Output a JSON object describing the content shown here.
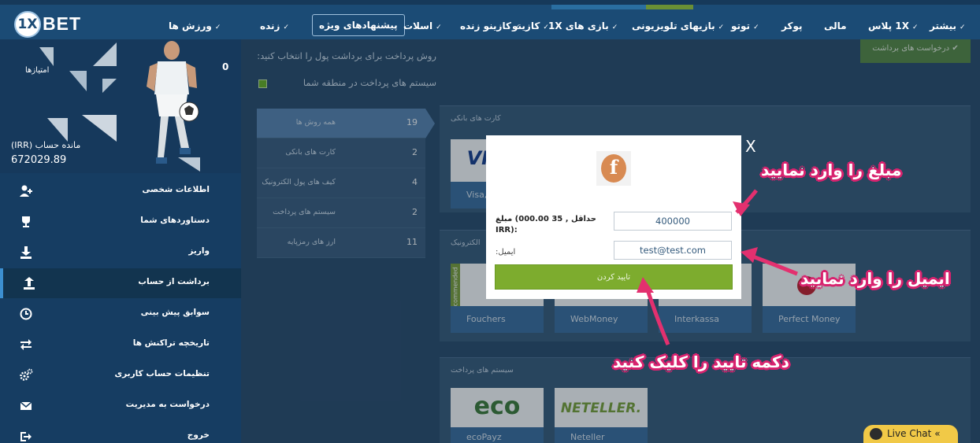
{
  "brand": {
    "logo_mark": "1X",
    "logo_word": "BET"
  },
  "nav": {
    "items": [
      {
        "label": "ورزش ها",
        "chevron": true
      },
      {
        "label": "زنده",
        "chevron": true
      },
      {
        "label": "پیشنهادهای ویژه",
        "chevron": false
      },
      {
        "label": "اسلات",
        "chevron": true
      },
      {
        "label": "کازینو زنده",
        "chevron": true
      },
      {
        "label": "کازینو",
        "chevron": true
      },
      {
        "label": "بازی های 1X",
        "chevron": true
      },
      {
        "label": "بازیهای تلویزیونی",
        "chevron": true
      },
      {
        "label": "توتو",
        "chevron": true
      },
      {
        "label": "پوکر",
        "chevron": false
      },
      {
        "label": "مالی",
        "chevron": false
      },
      {
        "label": "1X پلاس",
        "chevron": true
      },
      {
        "label": "بیشتر",
        "chevron": true
      }
    ]
  },
  "sidebar": {
    "points_label": "امتیازها",
    "points_value": "0",
    "balance_label": "(IRR) مانده حساب",
    "balance_value": "672029.89",
    "items": [
      {
        "label": "اطلاعات شخصی",
        "icon": "user-add-icon"
      },
      {
        "label": "دستاوردهای شما",
        "icon": "trophy-icon"
      },
      {
        "label": "واریز",
        "icon": "download-icon"
      },
      {
        "label": "برداشت از حساب",
        "icon": "upload-icon"
      },
      {
        "label": "سوابق پیش بینی",
        "icon": "clock-icon"
      },
      {
        "label": "تاریخچه تراکنش ها",
        "icon": "transfer-icon"
      },
      {
        "label": "تنظیمات حساب کاربری",
        "icon": "gears-icon"
      },
      {
        "label": "درخواست به مدیریت",
        "icon": "envelope-icon"
      },
      {
        "label": "خروج",
        "icon": "logout-icon"
      }
    ]
  },
  "main": {
    "choose_method": "روش پرداخت برای برداشت پول را انتخاب کنید:",
    "region_systems": "سیستم های پرداخت در منطقه شما",
    "withdraw_requests": "درخواست های برداشت",
    "categories": [
      {
        "label": "همه روش ها",
        "count": "19"
      },
      {
        "label": "کارت های بانکی",
        "count": "2"
      },
      {
        "label": "کیف های پول الکترونیک",
        "count": "4"
      },
      {
        "label": "سیستم های پرداخت",
        "count": "2"
      },
      {
        "label": "ارز های رمزپایه",
        "count": "11"
      }
    ],
    "panels": {
      "bank_title": "کارت های بانکی",
      "ewallet_title": "الکترونیک",
      "payment_title": "سیستم های پرداخت"
    },
    "cards": {
      "visa_brand": "VIS",
      "visa_cap": "Visa,",
      "recommended": "Recommended",
      "fouchers": "Fouchers",
      "webmoney": "WebMoney",
      "interkassa": "Interkassa",
      "perfect": "Perfect Money",
      "eco_brand": "eco",
      "eco_cap": "ecoPayz",
      "neteller_brand": "NETELLER.",
      "neteller_cap": "Neteller"
    }
  },
  "modal": {
    "amount_label": "مبلغ (حداقل , 35 000.00 IRR):",
    "amount_value": "400000",
    "email_label": "ایمیل:",
    "email_value": "test@test.com",
    "confirm_label": "تایید کردن",
    "close": "X"
  },
  "annotations": {
    "enter_amount": "مبلغ را وارد نمایید",
    "enter_email": "ایمیل را وارد نمایید",
    "click_confirm": "دکمه تایید را کلیک کنید",
    "color": "#d8236f"
  },
  "livechat": {
    "label": "Live Chat",
    "chevron": "«"
  }
}
